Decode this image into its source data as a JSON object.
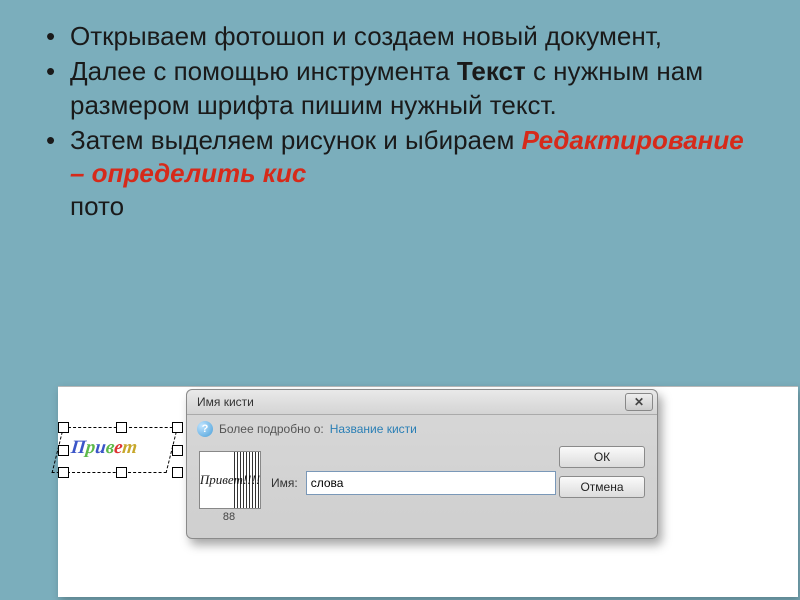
{
  "bullets": {
    "b1": "Открываем фотошоп и создаем новый документ,",
    "b2_pre": "Далее с помощью инструмента ",
    "b2_bold": "Текст",
    "b2_post": " с нужным нам размером шрифта пишим нужный текст.",
    "b3_pre": "Затем выделяем рисунок и ыбираем ",
    "b3_em": "Редактирование – определить кис",
    "b3_tail_visible": "пото"
  },
  "canvas_sample": {
    "chars": [
      "П",
      "р",
      "и",
      "в",
      "е",
      "т"
    ]
  },
  "dialog": {
    "title": "Имя кисти",
    "info_prefix": "Более подробно о: ",
    "info_link": "Название кисти",
    "thumb_text": "Привет!!!!",
    "thumb_caption": "88",
    "name_label": "Имя:",
    "name_value": "слова",
    "ok": "ОК",
    "cancel": "Отмена"
  }
}
